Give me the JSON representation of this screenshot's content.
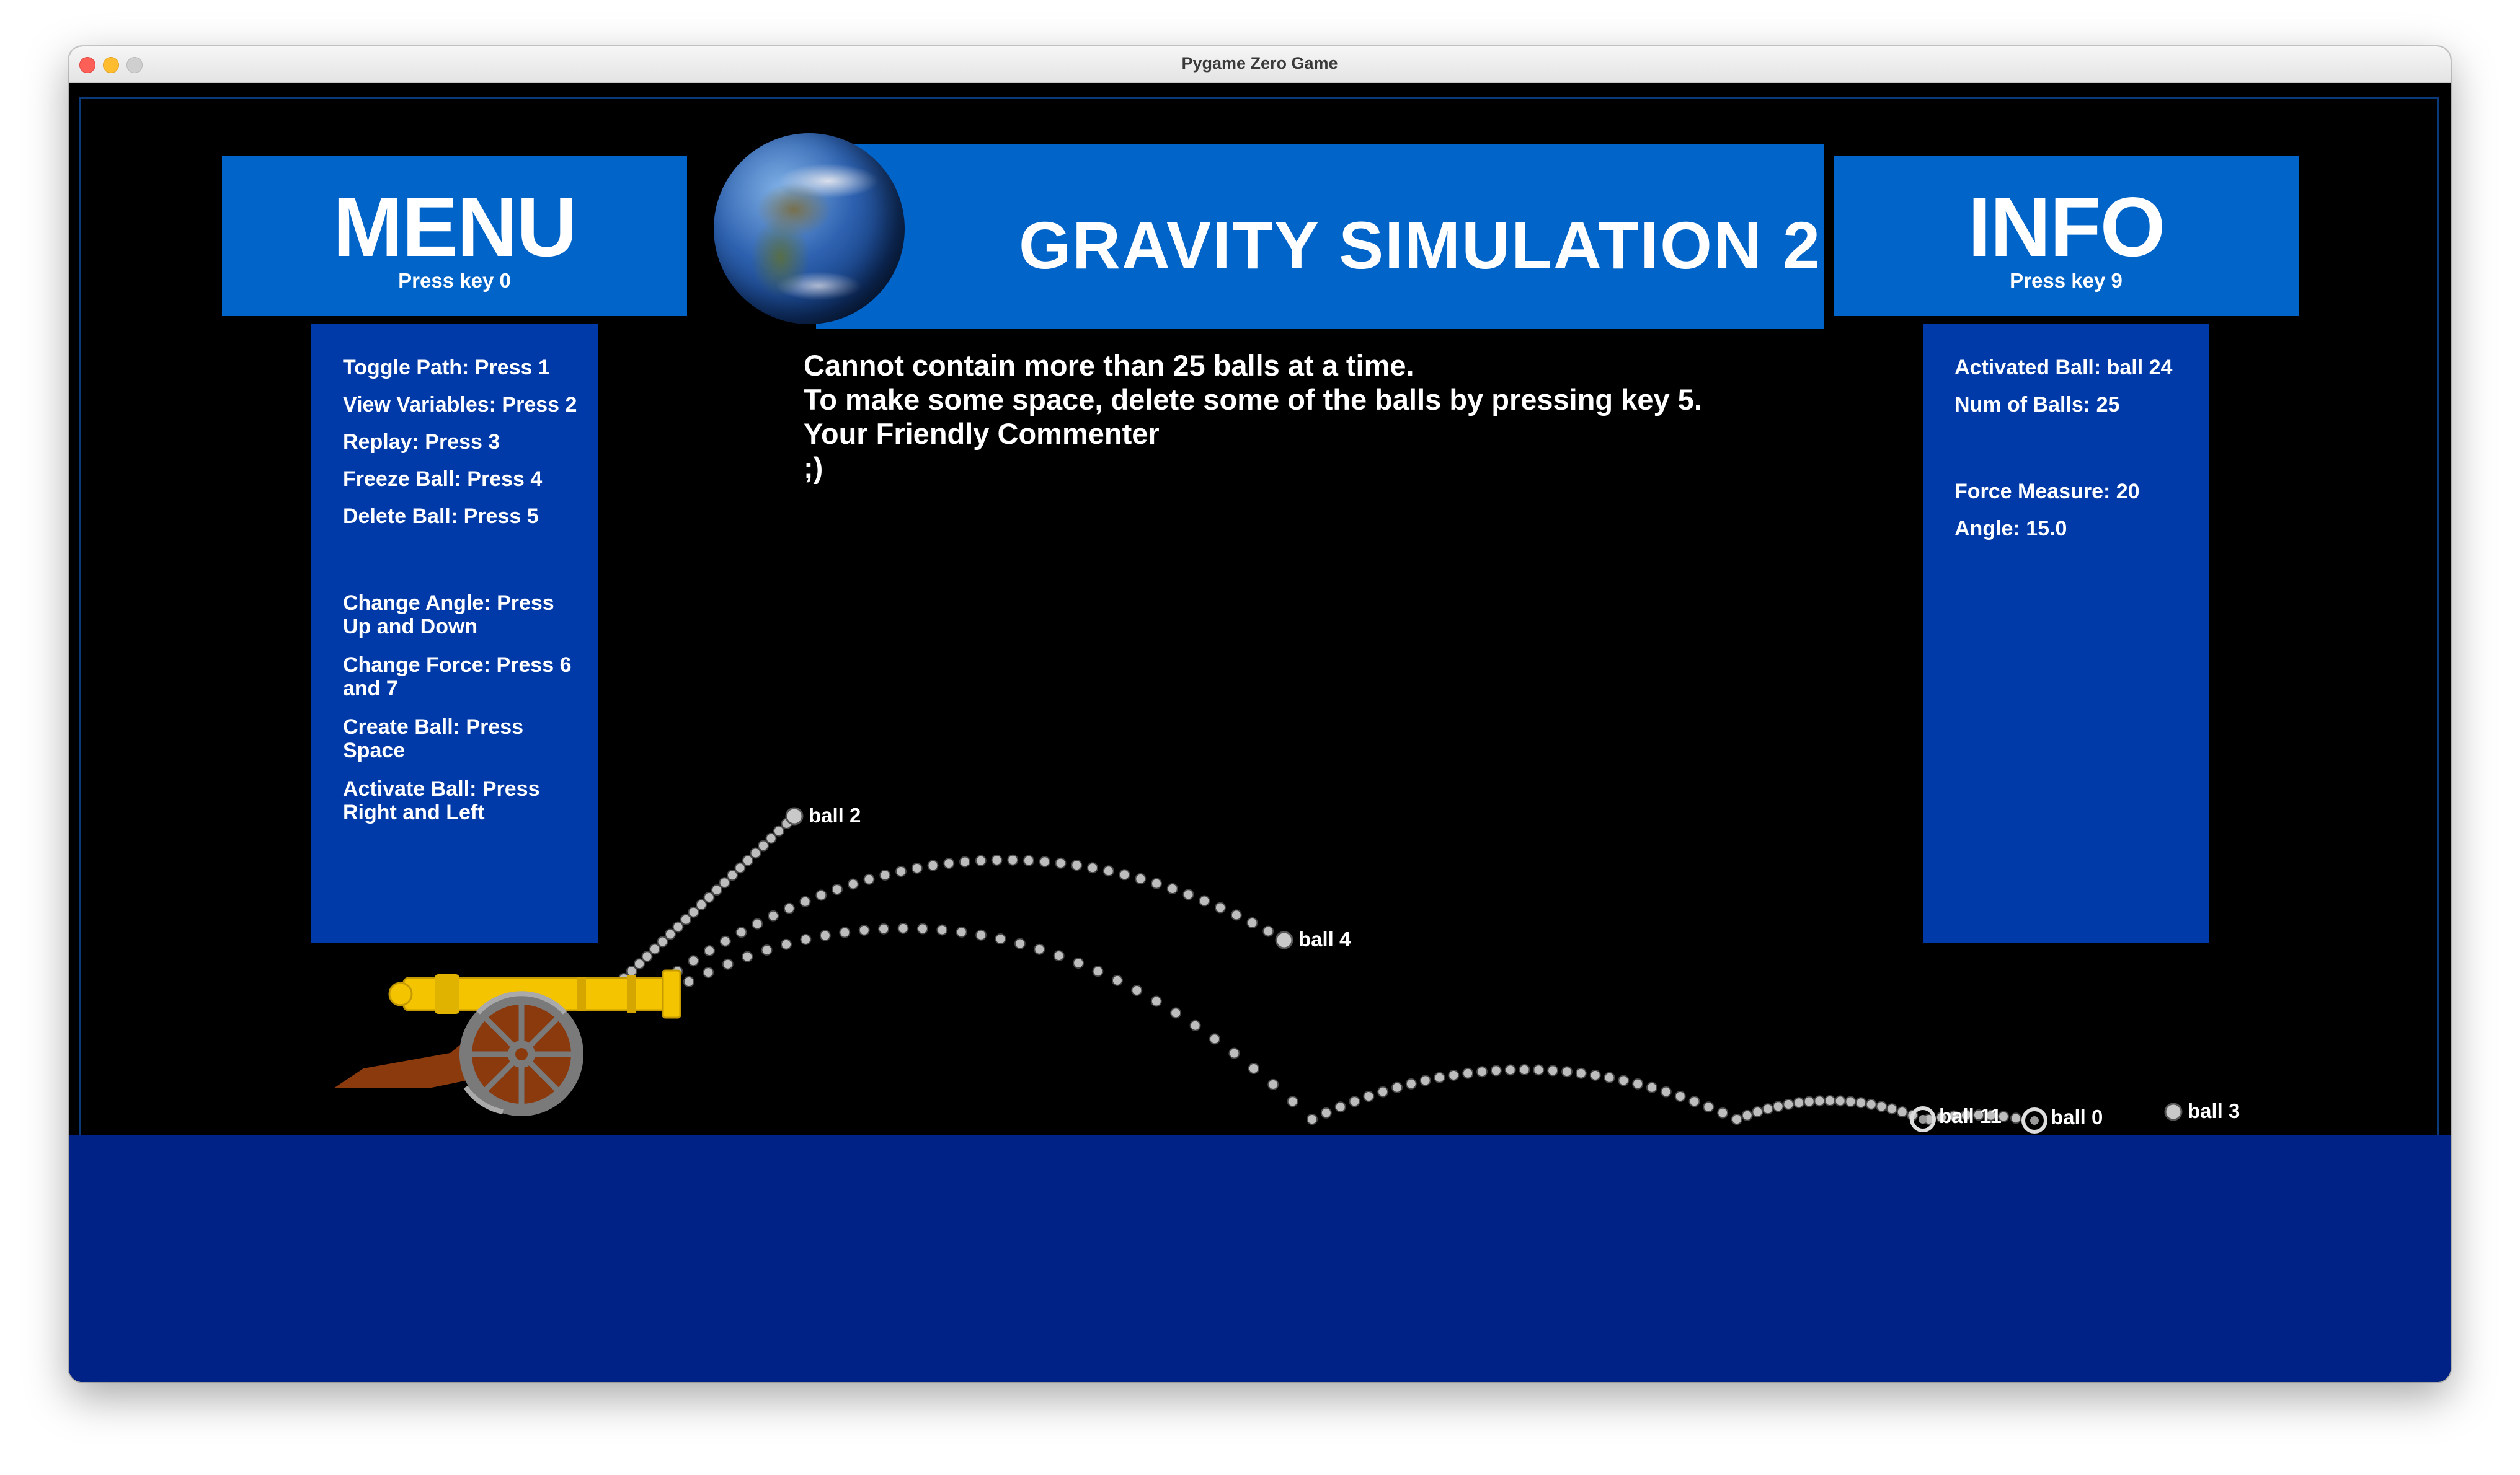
{
  "window": {
    "title": "Pygame Zero Game"
  },
  "title_banner": {
    "text": "GRAVITY SIMULATION 2"
  },
  "menu": {
    "heading": "MENU",
    "hint": "Press key 0",
    "items": [
      "Toggle Path: Press 1",
      "View Variables: Press 2",
      "Replay: Press 3",
      "Freeze Ball: Press 4",
      "Delete Ball: Press 5",
      "Change Angle: Press Up and Down",
      "Change Force: Press 6 and 7",
      "Create Ball: Press Space",
      "Activate Ball: Press Right and Left"
    ]
  },
  "info": {
    "heading": "INFO",
    "hint": "Press key 9",
    "activated_ball": "Activated Ball: ball 24",
    "num_balls": "Num of Balls: 25",
    "force": "Force Measure: 20",
    "angle": "Angle: 15.0"
  },
  "commenter": {
    "line1": "Cannot contain more than 25 balls at a time.",
    "line2": "To make some space, delete some of the balls by pressing key 5.",
    "line3": "Your Friendly Commenter",
    "line4": ";)"
  },
  "balls": {
    "ball2": "ball 2",
    "ball4": "ball 4",
    "ball3": "ball 3",
    "ball0": "ball 0",
    "ball_cluster": "ball 11"
  },
  "colors": {
    "panel_head": "#0064c8",
    "panel_body": "#0039a8",
    "ground": "#002186",
    "cannon_barrel": "#f5c400",
    "cannon_carriage": "#8b3a0e"
  }
}
